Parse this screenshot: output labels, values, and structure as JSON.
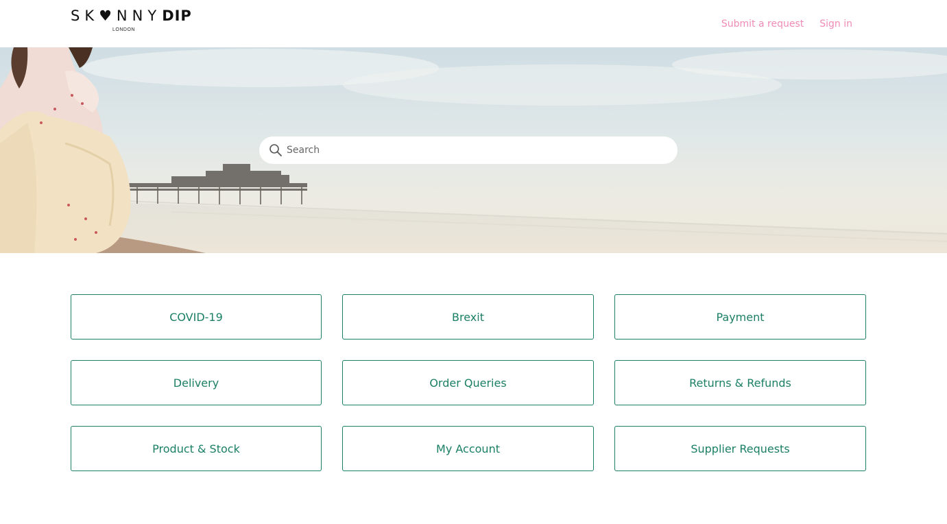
{
  "header": {
    "logo": {
      "skinny": "SK♥NNY",
      "dip": "DIP",
      "sub": "LONDON"
    },
    "nav": {
      "submit_request": "Submit a request",
      "sign_in": "Sign in"
    }
  },
  "hero": {
    "search": {
      "placeholder": "Search",
      "value": "",
      "icon": "search-icon"
    }
  },
  "categories": [
    {
      "label": "COVID-19"
    },
    {
      "label": "Brexit"
    },
    {
      "label": "Payment"
    },
    {
      "label": "Delivery"
    },
    {
      "label": "Order Queries"
    },
    {
      "label": "Returns & Refunds"
    },
    {
      "label": "Product & Stock"
    },
    {
      "label": "My Account"
    },
    {
      "label": "Supplier Requests"
    }
  ],
  "colors": {
    "nav_link": "#f08bb5",
    "accent_green": "#1a7f64",
    "background": "#ffffff"
  }
}
